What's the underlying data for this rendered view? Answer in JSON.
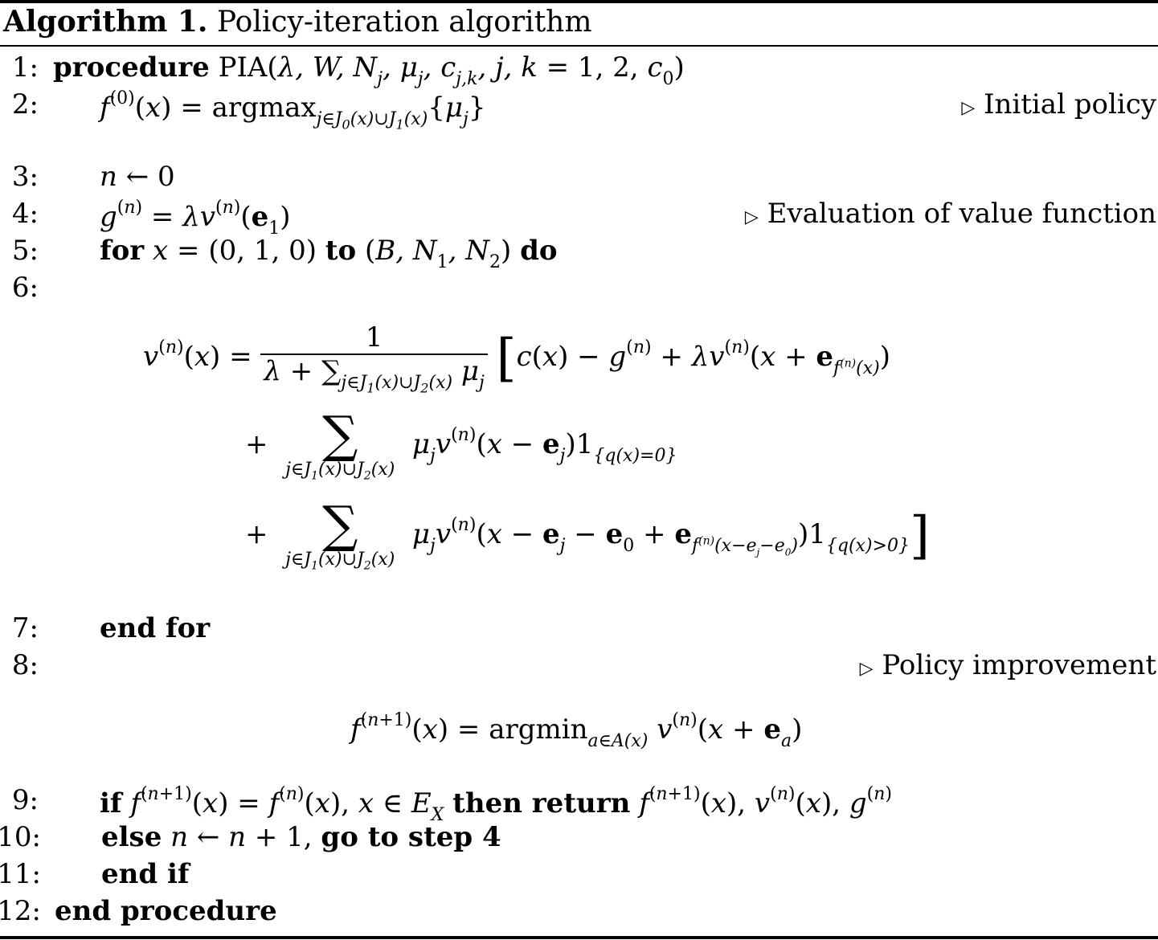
{
  "caption": {
    "label": "Algorithm 1.",
    "title": "Policy-iteration algorithm"
  },
  "lines": [
    {
      "num": "1:",
      "keyword": "procedure",
      "text": "PIA(λ, W, N_j, μ_j, c_{j,k}, j, k = 1, 2, c_0)"
    },
    {
      "num": "2:",
      "text": "f^(0)(x) = argmax_{j∈J_0(x)∪J_1(x)} {μ_j}",
      "comment": "Initial policy"
    },
    {
      "num": "3:",
      "text": "n ← 0"
    },
    {
      "num": "4:",
      "text": "g^(n) = λv^(n)(e_1)",
      "comment": "Evaluation of value function"
    },
    {
      "num": "5:",
      "keyword_for": "for",
      "text_mid": "x = (0, 1, 0)",
      "keyword_to": "to",
      "text_end": "(B, N_1, N_2)",
      "keyword_do": "do"
    },
    {
      "num": "6:",
      "text": ""
    },
    {
      "num": "7:",
      "keyword": "end for"
    },
    {
      "num": "8:",
      "text": "",
      "comment": "Policy improvement"
    },
    {
      "num": "9:",
      "keyword_if": "if",
      "cond": "f^(n+1)(x) = f^(n)(x), x ∈ E_X",
      "keyword_then": "then return",
      "ret": "f^(n+1)(x), v^(n)(x), g^(n)"
    },
    {
      "num": "10:",
      "keyword_else": "else",
      "text": "n ← n + 1,",
      "keyword_goto": "go to step 4"
    },
    {
      "num": "11:",
      "keyword": "end if"
    },
    {
      "num": "12:",
      "keyword": "end procedure"
    }
  ],
  "equations": {
    "value_update_line1": "v^(n)(x) = 1 / (λ + Σ_{j∈J_1(x)∪J_2(x)} μ_j) [ c(x) − g^(n) + λv^(n)(x + e_{f^(n)(x)})",
    "value_update_line2": "+ Σ_{j∈J_1(x)∪J_2(x)} μ_j v^(n)(x − e_j) 1_{q(x)=0}",
    "value_update_line3": "+ Σ_{j∈J_1(x)∪J_2(x)} μ_j v^(n)(x − e_j − e_0 + e_{f^(n)(x−e_j−e_0)}) 1_{q(x)>0} ]",
    "policy_improvement": "f^(n+1)(x) = argmin_{a∈A(x)} v^(n)(x + e_a)"
  },
  "symbols": {
    "comment_marker": "▷",
    "sigma": "∑",
    "num_one": "1",
    "lsq": "[",
    "rsq": "]"
  }
}
